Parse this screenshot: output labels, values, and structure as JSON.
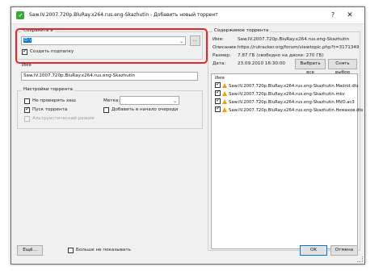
{
  "window": {
    "title": "Saw.IV.2007.720p.BluRay.x264.rus.eng-Skazhutin - Добавить новый торрент",
    "help_symbol": "?",
    "close_symbol": "✕"
  },
  "save_in": {
    "group_title": "Сохранить в",
    "path_value": "D:\\",
    "browse_label": "...",
    "create_subfolder_label": "Создать подпапку",
    "create_subfolder_checked": true
  },
  "name": {
    "label": "Имя",
    "value": "Saw.IV.2007.720p.BluRay.x264.rus.eng-Skazhutin"
  },
  "settings": {
    "group_title": "Настройки торрента",
    "skip_hash_label": "Не проверять хеш",
    "start_torrent_label": "Пуск торрента",
    "alt_mode_label": "Альтруистический режим",
    "label_label": "Метка:",
    "label_value": "",
    "add_to_top_label": "Добавить в начало очереди"
  },
  "contents": {
    "group_title": "Содержимое торрента",
    "name_key": "Имя:",
    "name_val": "Saw.IV.2007.720p.BluRay.x264.rus.eng-Skazhutin",
    "desc_key": "Описание:",
    "desc_val": "https://rutracker.org/forum/viewtopic.php?t=3171349",
    "size_key": "Размер:",
    "size_val": "7.87 ГБ (свободно на диске: 270 ГБ)",
    "date_key": "Дата:",
    "date_val": "23.09.2010 16:30:00",
    "select_all_label": "Выбрать все",
    "deselect_label": "Снять выбор",
    "files": [
      "Saw.IV.2007.720p.BluRay.x264.rus.eng-Skazhutin.Madrid.dts",
      "Saw.IV.2007.720p.BluRay.x264.rus.eng-Skazhutin.mkv",
      "Saw.IV.2007.720p.BluRay.x264.rus.eng-Skazhutin.MVO.ac3",
      "Saw.IV.2007.720p.BluRay.x264.rus.eng-Skazhutin.Немахов.dts"
    ]
  },
  "footer": {
    "more_label": "Ещё...",
    "dont_show_label": "Больше не показывать",
    "ok_label": "OK",
    "cancel_label": "Отмена"
  }
}
